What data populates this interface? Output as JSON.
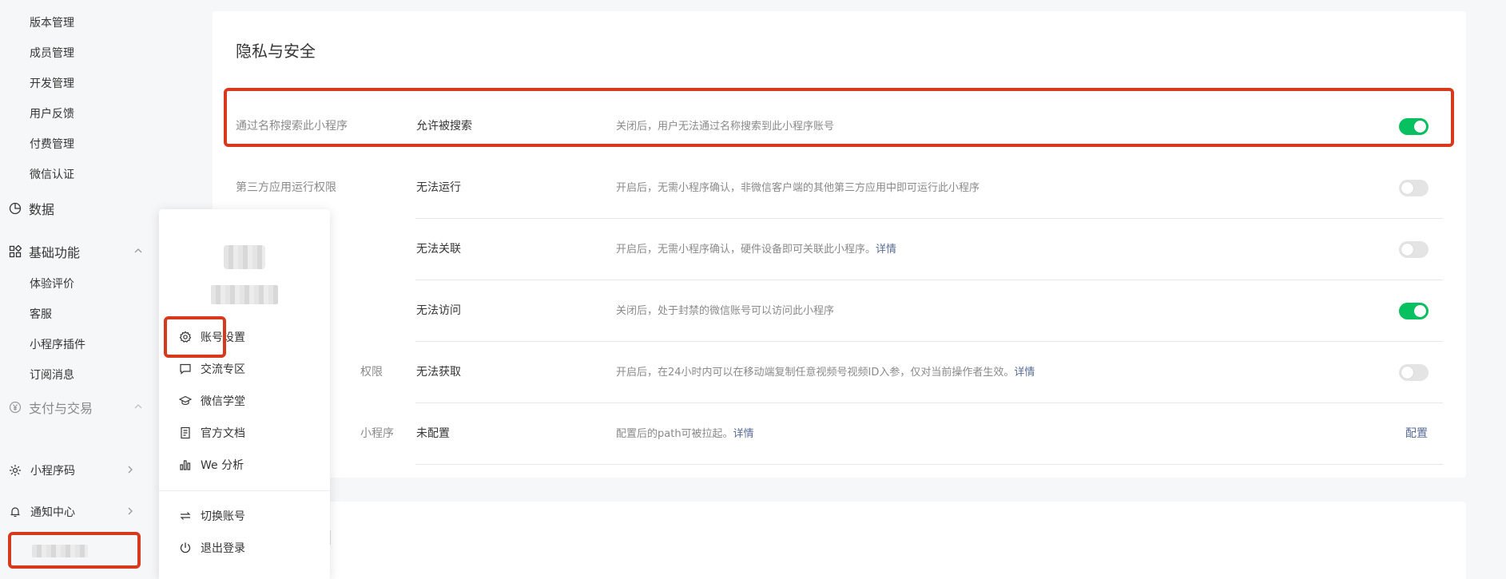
{
  "sidebar": {
    "sub_items_top": [
      "版本管理",
      "成员管理",
      "开发管理",
      "用户反馈",
      "付费管理",
      "微信认证"
    ],
    "data_group": {
      "label": "数据",
      "icon": "pie-chart-icon"
    },
    "basic_group": {
      "label": "基础功能",
      "icon": "grid-icon",
      "items": [
        "体验评价",
        "客服",
        "小程序插件",
        "订阅消息"
      ]
    },
    "pay_group": {
      "label": "支付与交易",
      "icon": "yen-icon"
    },
    "bottom_items": [
      {
        "label": "小程序码",
        "icon": "qrcode-sun-icon"
      },
      {
        "label": "通知中心",
        "icon": "bell-icon"
      }
    ]
  },
  "card": {
    "title": "隐私与安全",
    "rows": [
      {
        "name": "通过名称搜索此小程序",
        "status": "允许被搜索",
        "desc": "关闭后，用户无法通过名称搜索到此小程序账号",
        "link": "",
        "toggle": true
      },
      {
        "name": "第三方应用运行权限",
        "status": "无法运行",
        "desc": "开启后，无需小程序确认，非微信客户端的其他第三方应用中即可运行此小程序",
        "link": "",
        "toggle": false
      },
      {
        "name": "",
        "status": "无法关联",
        "desc": "开启后，无需小程序确认，硬件设备即可关联此小程序。",
        "link": "详情",
        "toggle": false
      },
      {
        "name": "",
        "status": "无法访问",
        "desc": "关闭后，处于封禁的微信账号可以访问此小程序",
        "link": "",
        "toggle": true
      },
      {
        "name": "权限",
        "status": "无法获取",
        "desc": "开启后，在24小时内可以在移动端复制任意视频号视频ID入参，仅对当前操作者生效。",
        "link": "详情",
        "toggle": false
      },
      {
        "name": "小程序",
        "status": "未配置",
        "desc": "配置后的path可被拉起。",
        "link": "详情",
        "action": "配置"
      }
    ]
  },
  "popup": {
    "items": [
      {
        "label": "账号设置",
        "icon": "gear-icon"
      },
      {
        "label": "交流专区",
        "icon": "chat-bubble-icon"
      },
      {
        "label": "微信学堂",
        "icon": "graduation-cap-icon"
      },
      {
        "label": "官方文档",
        "icon": "document-icon"
      },
      {
        "label": "We 分析",
        "icon": "analytics-icon"
      }
    ],
    "bottom_items": [
      {
        "label": "切换账号",
        "icon": "switch-arrows-icon"
      },
      {
        "label": "退出登录",
        "icon": "power-icon"
      }
    ]
  },
  "colors": {
    "accent_green": "#07c160",
    "highlight_red": "#d6391c",
    "link_blue": "#576b95"
  }
}
